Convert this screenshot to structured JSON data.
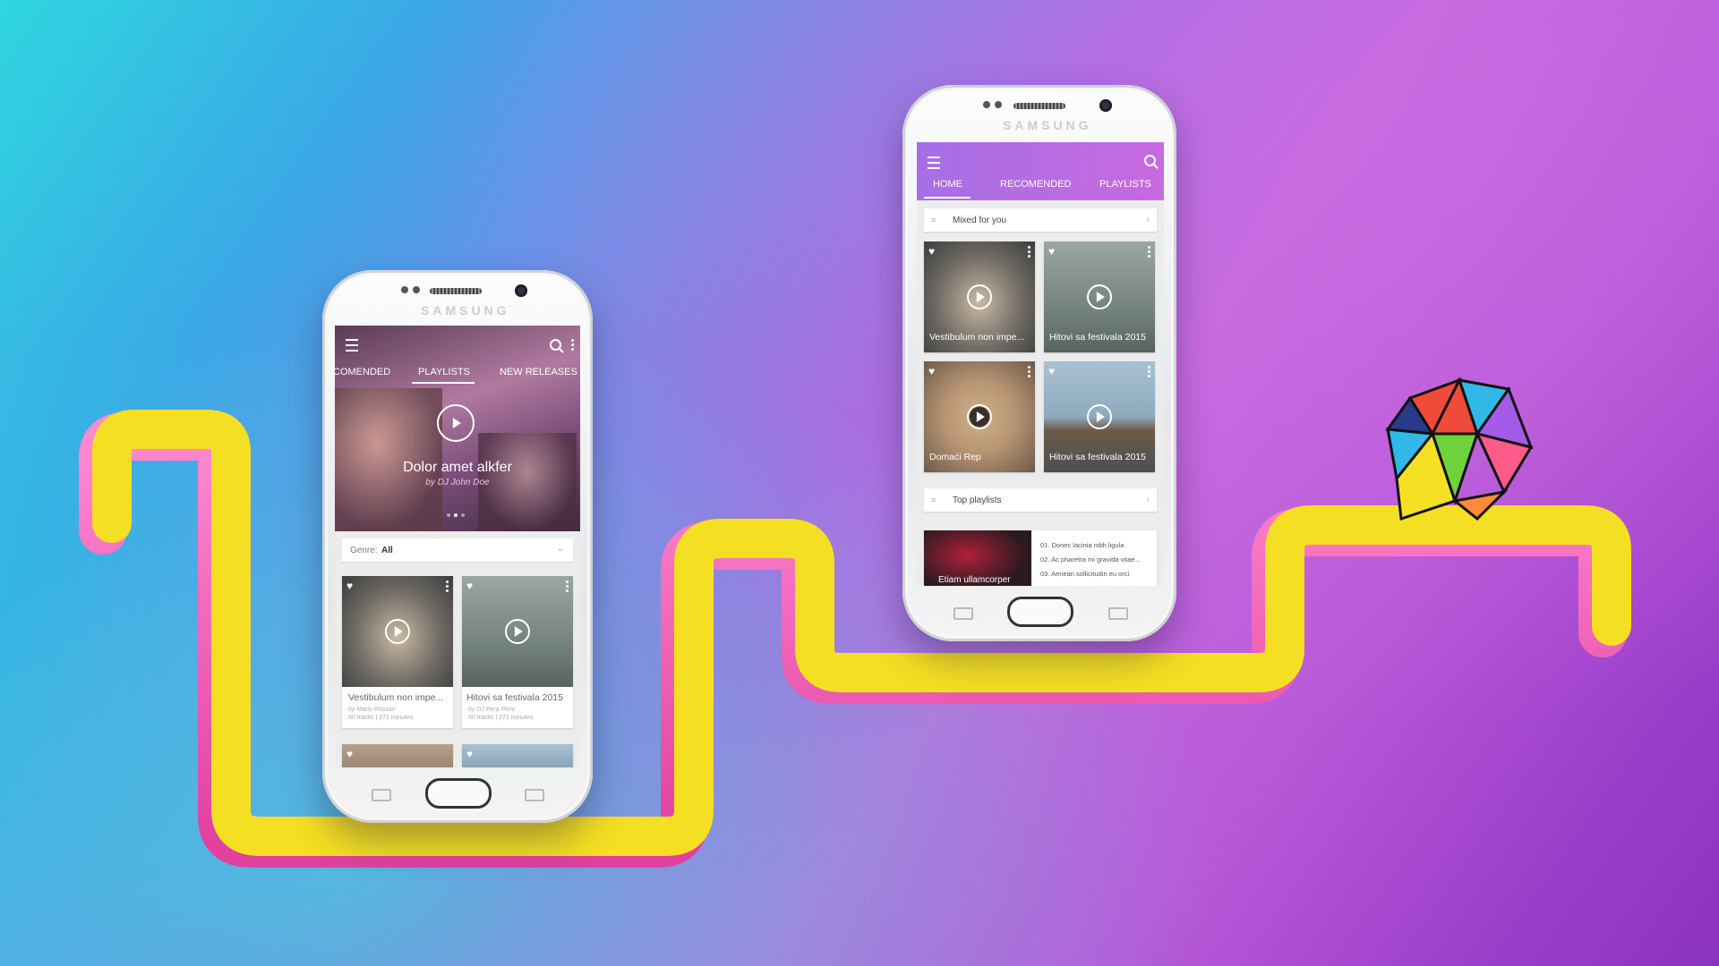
{
  "colors": {
    "accent": "#c36bdf",
    "path": "#f5df22"
  },
  "phone_left": {
    "brand": "SAMSUNG",
    "tabs": [
      "COMENDED",
      "PLAYLISTS",
      "NEW RELEASES"
    ],
    "hero": {
      "title": "Dolor amet alkfer",
      "subtitle": "by DJ John Doe"
    },
    "genre": {
      "label": "Genre:",
      "value": "All"
    },
    "cards": [
      {
        "title": "Vestibulum non impe...",
        "author": "by Mario Rossari",
        "meta": "60 tracks  |  272 minutes"
      },
      {
        "title": "Hitovi sa festivala 2015",
        "author": "by DJ Pera Peric",
        "meta": "60 tracks  |  272 minutes"
      }
    ]
  },
  "phone_right": {
    "brand": "SAMSUNG",
    "tabs": [
      "HOME",
      "RECOMENDED",
      "PLAYLISTS"
    ],
    "mixed": "Mixed for you",
    "cards": [
      {
        "title": "Vestibulum non impe..."
      },
      {
        "title": "Hitovi sa festivala 2015"
      },
      {
        "title": "Domaći Rep"
      },
      {
        "title": "Hitovi sa festivala 2015"
      }
    ],
    "top": "Top playlists",
    "tracks": [
      "01.  Donec lacinia nibh ligula",
      "02.  Ac pharetra mi gravida vitae...",
      "03.  Aenean sollicitudin eu orci"
    ],
    "album": "Etiam ullamcorper"
  }
}
